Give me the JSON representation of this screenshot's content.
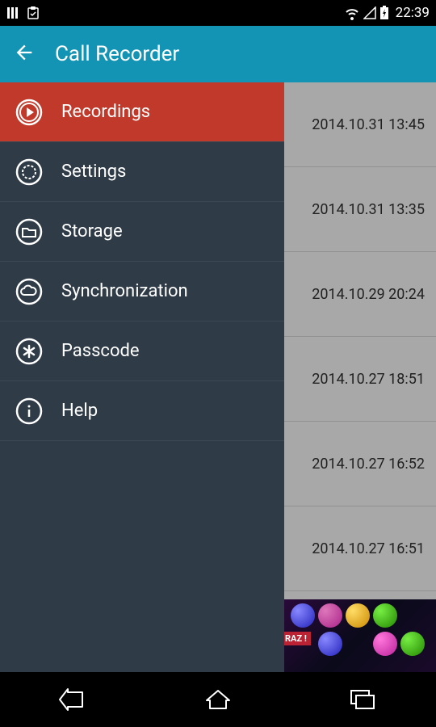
{
  "status_bar": {
    "time": "22:39"
  },
  "app_bar": {
    "title": "Call Recorder"
  },
  "drawer": {
    "items": [
      {
        "label": "Recordings",
        "icon": "play",
        "selected": true
      },
      {
        "label": "Settings",
        "icon": "gear",
        "selected": false
      },
      {
        "label": "Storage",
        "icon": "folder",
        "selected": false
      },
      {
        "label": "Synchronization",
        "icon": "cloud",
        "selected": false
      },
      {
        "label": "Passcode",
        "icon": "asterisk",
        "selected": false
      },
      {
        "label": "Help",
        "icon": "info",
        "selected": false
      }
    ]
  },
  "recordings": {
    "rows": [
      {
        "time": "2014.10.31 13:45"
      },
      {
        "time": "2014.10.31 13:35"
      },
      {
        "time": "2014.10.29 20:24"
      },
      {
        "time": "2014.10.27 18:51"
      },
      {
        "time": "2014.10.27 16:52"
      },
      {
        "time": "2014.10.27 16:51"
      }
    ]
  },
  "ad": {
    "tag": "RAZ !"
  }
}
